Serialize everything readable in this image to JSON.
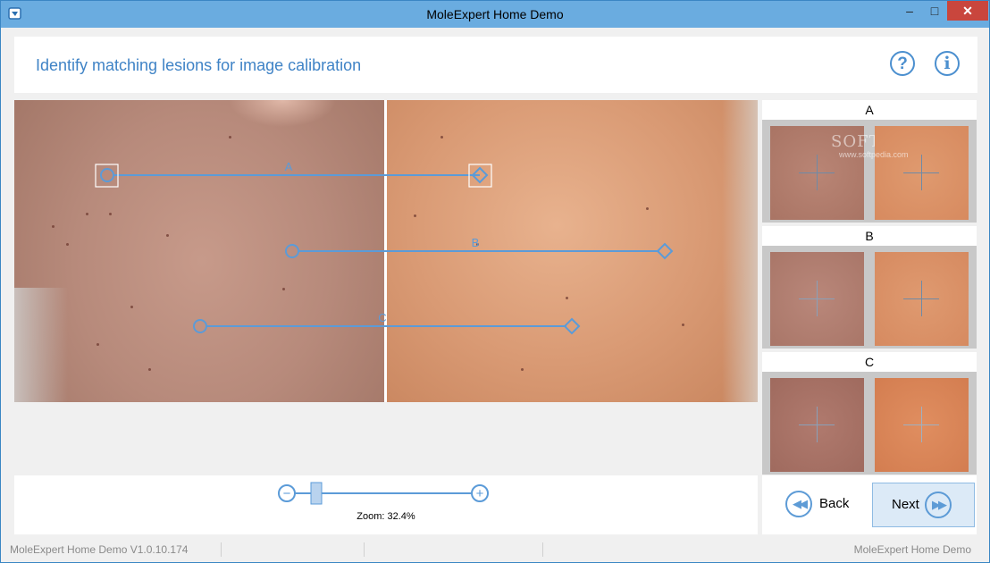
{
  "window": {
    "title": "MoleExpert Home Demo",
    "minimize": "–",
    "maximize": "□",
    "close": "✕"
  },
  "header": {
    "title": "Identify matching lesions for image calibration",
    "help_icon": "?",
    "info_icon": "i"
  },
  "viewer": {
    "markers": [
      {
        "label": "A"
      },
      {
        "label": "B"
      },
      {
        "label": "C"
      }
    ],
    "colors": {
      "line": "#5b9bd8",
      "selection": "#ffffff"
    }
  },
  "zoom": {
    "label": "Zoom: 32.4%",
    "level_percent": 32.4,
    "minus": "−",
    "plus": "+"
  },
  "pairs": [
    {
      "label": "A"
    },
    {
      "label": "B"
    },
    {
      "label": "C"
    }
  ],
  "watermark": {
    "text": "SOFTPEDIA",
    "sub": "www.softpedia.com"
  },
  "nav": {
    "back_label": "Back",
    "next_label": "Next",
    "back_icon": "◀◀",
    "next_icon": "▶▶"
  },
  "status": {
    "left": "MoleExpert Home Demo V1.0.10.174",
    "right": "MoleExpert Home Demo"
  }
}
